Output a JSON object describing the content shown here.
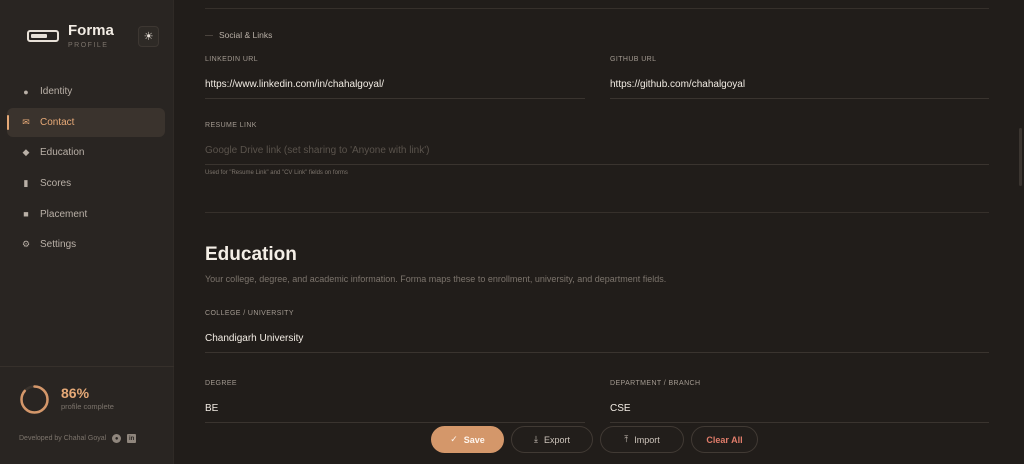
{
  "brand": {
    "name": "Forma",
    "subtitle": "PROFILE",
    "theme_icon": "sun-icon"
  },
  "nav": [
    {
      "label": "Identity",
      "icon": "user-icon",
      "glyph": "👤",
      "active": false
    },
    {
      "label": "Contact",
      "icon": "mail-icon",
      "glyph": "✉",
      "active": true
    },
    {
      "label": "Education",
      "icon": "graduation-cap-icon",
      "glyph": "🎓",
      "active": false
    },
    {
      "label": "Scores",
      "icon": "bar-chart-icon",
      "glyph": "▮",
      "active": false
    },
    {
      "label": "Placement",
      "icon": "briefcase-icon",
      "glyph": "💼",
      "active": false
    },
    {
      "label": "Settings",
      "icon": "gear-icon",
      "glyph": "⚙",
      "active": false
    }
  ],
  "profile": {
    "percent_text": "86%",
    "percent_value": 0.86,
    "label": "profile complete"
  },
  "footer": {
    "developer": "Developed by Chahal Goyal"
  },
  "social": {
    "heading": "Social & Links",
    "linkedin": {
      "label": "LINKEDIN URL",
      "value": "https://www.linkedin.com/in/chahalgoyal/"
    },
    "github": {
      "label": "GITHUB URL",
      "value": "https://github.com/chahalgoyal"
    },
    "resume": {
      "label": "RESUME LINK",
      "placeholder": "Google Drive link (set sharing to 'Anyone with link')",
      "hint": "Used for \"Resume Link\" and \"CV Link\" fields on forms"
    }
  },
  "education": {
    "title": "Education",
    "description": "Your college, degree, and academic information. Forma maps these to enrollment, university, and department fields.",
    "college": {
      "label": "COLLEGE / UNIVERSITY",
      "value": "Chandigarh University"
    },
    "degree": {
      "label": "DEGREE",
      "value": "BE"
    },
    "department": {
      "label": "DEPARTMENT / BRANCH",
      "value": "CSE"
    }
  },
  "actions": {
    "save": "Save",
    "export": "Export",
    "import": "Import",
    "clear": "Clear All"
  },
  "colors": {
    "accent": "#e6a977",
    "save_bg": "#d4976a",
    "danger": "#e07c6a",
    "background": "#211d1a",
    "sidebar": "#292522"
  }
}
